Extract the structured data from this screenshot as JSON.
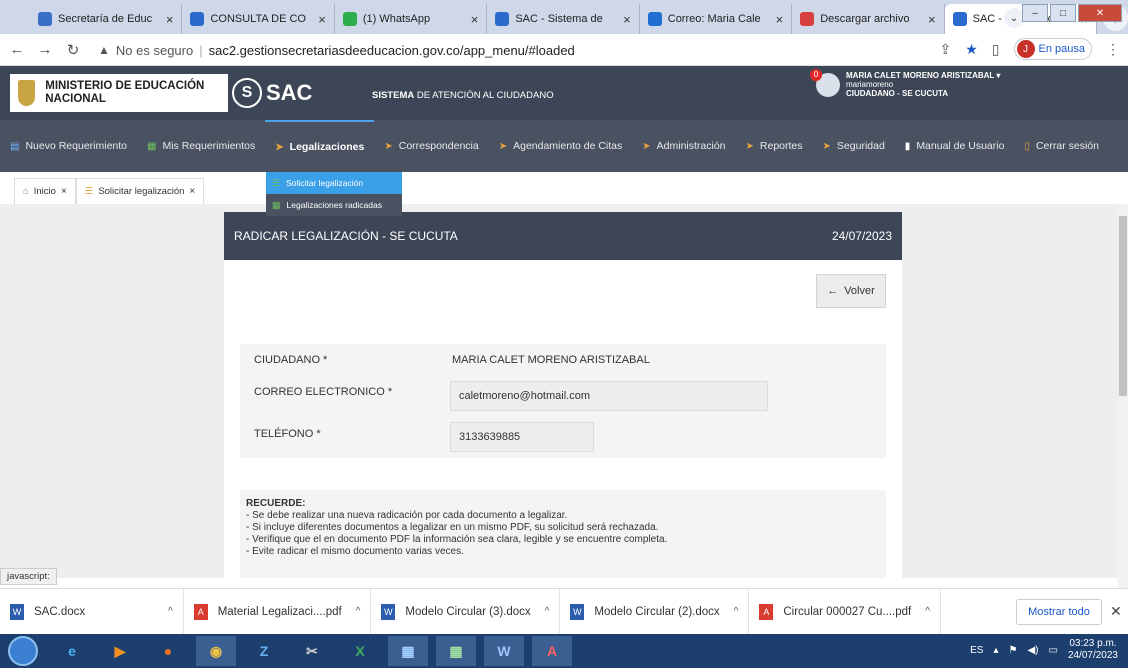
{
  "browser": {
    "tabs": [
      {
        "title": "Secretaría de Educ",
        "color": "#3a6fc8"
      },
      {
        "title": "CONSULTA DE CO",
        "color": "#2a6acc"
      },
      {
        "title": "(1) WhatsApp",
        "color": "#2cae4a"
      },
      {
        "title": "SAC - Sistema de",
        "color": "#2a6acc"
      },
      {
        "title": "Correo: Maria Cale",
        "color": "#1f6fd0"
      },
      {
        "title": "Descargar archivo",
        "color": "#d84040"
      },
      {
        "title": "SAC - Sistema de",
        "color": "#2a6acc"
      }
    ],
    "new_tab": "+",
    "insecure_label": "No es seguro",
    "url": "sac2.gestionsecretariasdeeducacion.gov.co/app_menu/#loaded",
    "profile_initial": "J",
    "profile_status": "En pausa"
  },
  "header": {
    "ministry": "MINISTERIO DE EDUCACIÓN NACIONAL",
    "logo_letter": "S",
    "logo_word": "SAC",
    "system_title_bold": "SISTEMA",
    "system_title_rest": "DE ATENCIÓN AL CIUDADANO",
    "notif_count": "0",
    "user_name": "MARIA CALET MORENO ARISTIZABAL",
    "user_login": "mariamoreno",
    "user_role": "CIUDADANO - SE CUCUTA"
  },
  "nav": [
    "Nuevo Requerimiento",
    "Mis Requerimientos",
    "Legalizaciones",
    "Correspondencia",
    "Agendamiento de Citas",
    "Administración",
    "Reportes",
    "Seguridad",
    "Manual de Usuario",
    "Cerrar sesión"
  ],
  "dropdown": [
    "Solicitar legalización",
    "Legalizaciones radicadas"
  ],
  "page_tabs": [
    "Inicio",
    "Solicitar legalización"
  ],
  "panel": {
    "title": "RADICAR LEGALIZACIÓN - SE CUCUTA",
    "date": "24/07/2023",
    "back_label": "Volver",
    "fields": {
      "citizen_label": "CIUDADANO *",
      "citizen_value": "MARIA CALET MORENO ARISTIZABAL",
      "email_label": "CORREO ELECTRONICO *",
      "email_value": "caletmoreno@hotmail.com",
      "phone_label": "TELÉFONO *",
      "phone_value": "3133639885"
    },
    "reminder_title": "RECUERDE:",
    "reminders": [
      "- Se debe realizar una nueva radicación por cada documento a legalizar.",
      "- Si incluye diferentes documentos a legalizar en un mismo PDF, su solicitud será rechazada.",
      "- Verifique que el en documento PDF la información sea clara, legible y se encuentre completa.",
      "- Evite radicar el mismo documento varias veces."
    ]
  },
  "status_text": "javascript:",
  "downloads": [
    {
      "name": "SAC.docx",
      "kind": "word"
    },
    {
      "name": "Material Legalizaci....pdf",
      "kind": "pdf"
    },
    {
      "name": "Modelo Circular (3).docx",
      "kind": "word"
    },
    {
      "name": "Modelo Circular (2).docx",
      "kind": "word"
    },
    {
      "name": "Circular 000027 Cu....pdf",
      "kind": "pdf"
    }
  ],
  "show_all": "Mostrar todo",
  "taskbar": {
    "lang": "ES",
    "time": "03:23 p.m.",
    "date": "24/07/2023"
  }
}
